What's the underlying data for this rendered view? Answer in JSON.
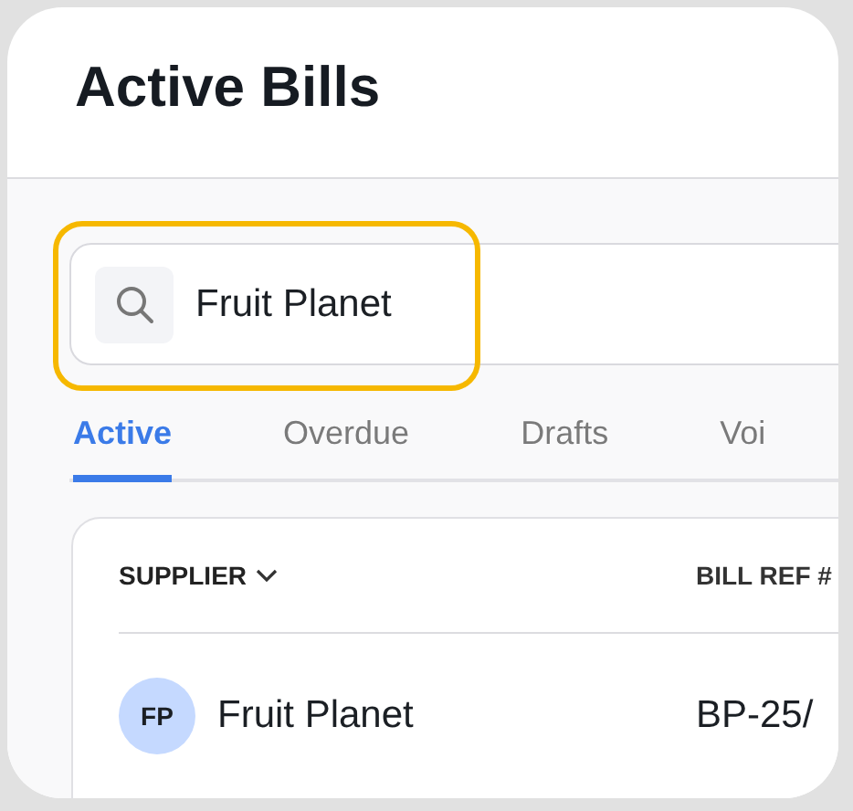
{
  "page": {
    "title": "Active Bills"
  },
  "search": {
    "value": "Fruit Planet",
    "highlighted": true
  },
  "tabs": [
    {
      "label": "Active",
      "selected": true
    },
    {
      "label": "Overdue",
      "selected": false
    },
    {
      "label": "Drafts",
      "selected": false
    },
    {
      "label": "Voi",
      "selected": false
    }
  ],
  "table": {
    "columns": [
      {
        "label": "SUPPLIER",
        "sorted": true
      },
      {
        "label": "BILL REF #",
        "sorted": false
      }
    ],
    "rows": [
      {
        "initials": "FP",
        "supplier": "Fruit Planet",
        "bill_ref": "BP-25/"
      }
    ]
  }
}
